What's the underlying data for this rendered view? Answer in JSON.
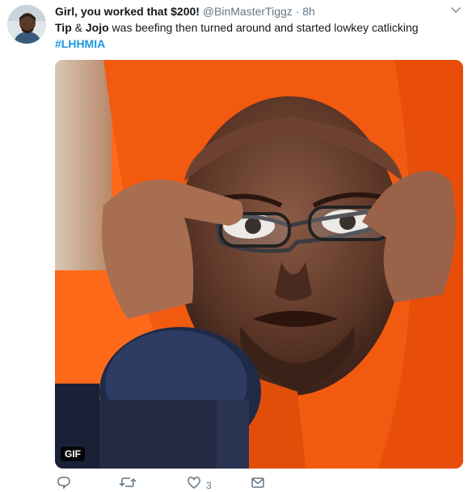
{
  "tweet": {
    "display_name": "Girl, you worked that $200!",
    "handle": "@BinMasterTiggz",
    "separator": "·",
    "time": "8h",
    "text_name1": "Tip",
    "text_amp": " & ",
    "text_name2": "Jojo",
    "text_rest": " was beefing then turned around and started lowkey catlicking",
    "hashtag": "#LHHMIA",
    "media_badge": "GIF",
    "like_count": "3"
  },
  "icons": {
    "avatar": "profile-photo",
    "caret": "chevron-down-icon",
    "reply": "reply-icon",
    "retweet": "retweet-icon",
    "like": "heart-icon",
    "message": "envelope-icon"
  },
  "colors": {
    "link": "#1b95e0",
    "secondary_text": "#657786",
    "primary_text": "#14171a",
    "media_background": "#ff6a1a"
  }
}
